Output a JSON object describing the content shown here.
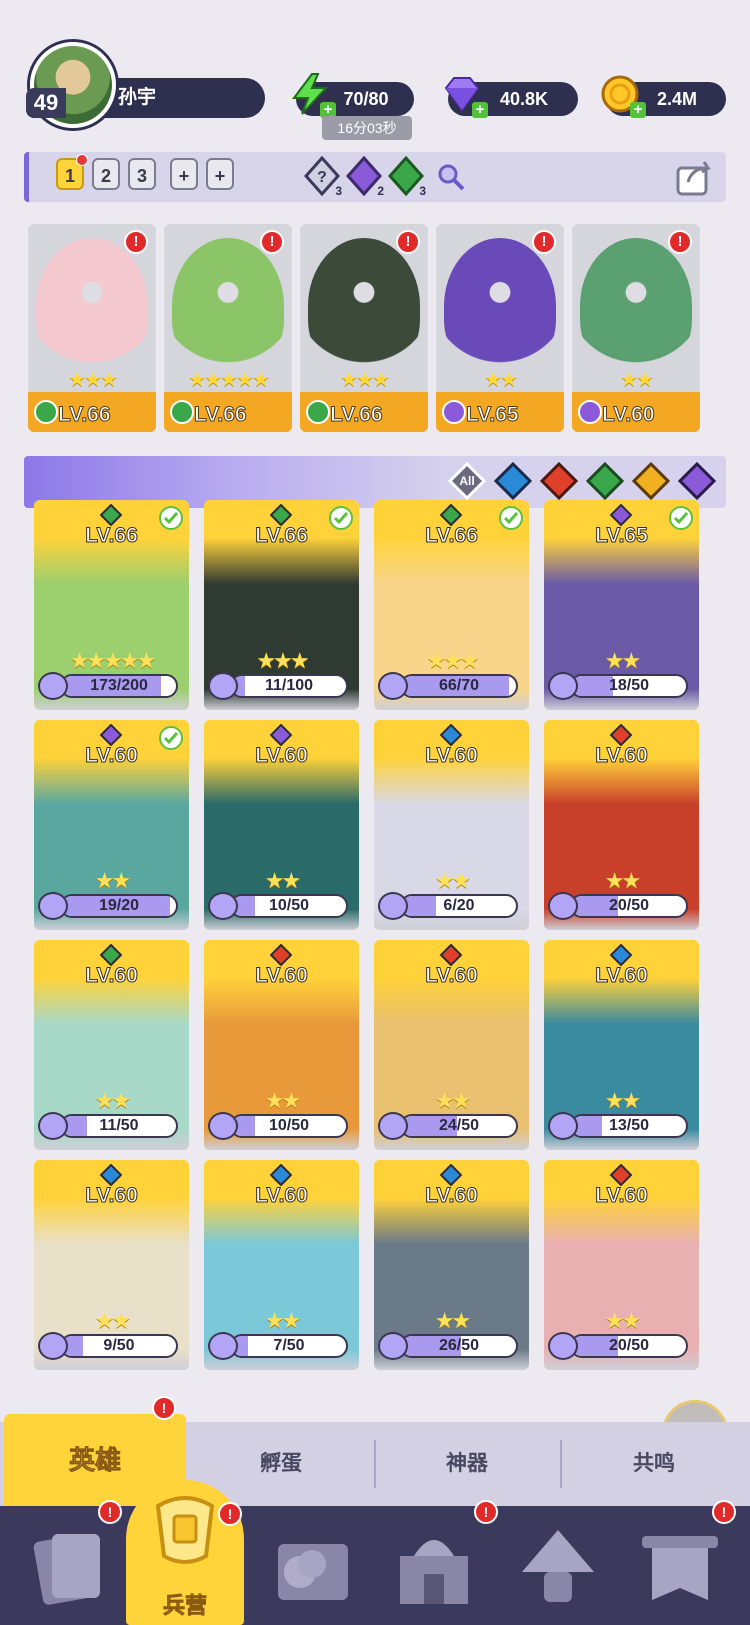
{
  "player": {
    "level": "49",
    "name": "孙宇"
  },
  "resources": {
    "energy": {
      "icon": "lightning-icon",
      "value": "70/80",
      "timer": "16分03秒"
    },
    "gems": {
      "icon": "gem-icon",
      "value": "40.8K"
    },
    "gold": {
      "icon": "coin-icon",
      "value": "2.4M"
    }
  },
  "teams": {
    "tabs": [
      "1",
      "2",
      "3",
      "+",
      "+"
    ],
    "active": "1",
    "element_counts": [
      "3",
      "2",
      "3"
    ]
  },
  "team_heroes": [
    {
      "element": "nature",
      "stars": "★★★",
      "level": "LV.66",
      "art": "#f5c9d0"
    },
    {
      "element": "nature",
      "stars": "★★★★★",
      "level": "LV.66",
      "art": "#8cc468"
    },
    {
      "element": "nature",
      "stars": "★★★",
      "level": "LV.66",
      "art": "#3c4a3a"
    },
    {
      "element": "dark",
      "stars": "★★",
      "level": "LV.65",
      "art": "#6a4ab8"
    },
    {
      "element": "dark",
      "stars": "★★",
      "level": "LV.60",
      "art": "#5aa070"
    }
  ],
  "filters": {
    "all_label": "All",
    "elements": [
      "water",
      "fire",
      "nature",
      "light",
      "dark"
    ]
  },
  "heroes": [
    {
      "element": "nature",
      "level": "LV.66",
      "stars": "★★★★★",
      "progress": "173/200",
      "ratio": 0.865,
      "equipped": true,
      "art": "#9ccf6e"
    },
    {
      "element": "nature",
      "level": "LV.66",
      "stars": "★★★",
      "progress": "11/100",
      "ratio": 0.11,
      "equipped": true,
      "art": "#2f3a32"
    },
    {
      "element": "nature",
      "level": "LV.66",
      "stars": "★★★",
      "progress": "66/70",
      "ratio": 0.94,
      "equipped": true,
      "art": "#f8d58a"
    },
    {
      "element": "dark",
      "level": "LV.65",
      "stars": "★★",
      "progress": "18/50",
      "ratio": 0.36,
      "equipped": true,
      "art": "#6a5aa8"
    },
    {
      "element": "dark",
      "level": "LV.60",
      "stars": "★★",
      "progress": "19/20",
      "ratio": 0.95,
      "equipped": true,
      "art": "#5aa7a0"
    },
    {
      "element": "dark",
      "level": "LV.60",
      "stars": "★★",
      "progress": "10/50",
      "ratio": 0.2,
      "equipped": false,
      "art": "#2a6a68"
    },
    {
      "element": "water",
      "level": "LV.60",
      "stars": "★★",
      "progress": "6/20",
      "ratio": 0.3,
      "equipped": false,
      "art": "#d8d8e6"
    },
    {
      "element": "fire",
      "level": "LV.60",
      "stars": "★★",
      "progress": "20/50",
      "ratio": 0.4,
      "equipped": false,
      "art": "#c8402a"
    },
    {
      "element": "nature",
      "level": "LV.60",
      "stars": "★★",
      "progress": "11/50",
      "ratio": 0.22,
      "equipped": false,
      "art": "#a8d8c8"
    },
    {
      "element": "fire",
      "level": "LV.60",
      "stars": "★★",
      "progress": "10/50",
      "ratio": 0.2,
      "equipped": false,
      "art": "#e89a3a"
    },
    {
      "element": "fire",
      "level": "LV.60",
      "stars": "★★",
      "progress": "24/50",
      "ratio": 0.48,
      "equipped": false,
      "art": "#e8c070"
    },
    {
      "element": "water",
      "level": "LV.60",
      "stars": "★★",
      "progress": "13/50",
      "ratio": 0.26,
      "equipped": false,
      "art": "#3a8aa0"
    },
    {
      "element": "water",
      "level": "LV.60",
      "stars": "★★",
      "progress": "9/50",
      "ratio": 0.18,
      "equipped": false,
      "art": "#e8e0c8"
    },
    {
      "element": "water",
      "level": "LV.60",
      "stars": "★★",
      "progress": "7/50",
      "ratio": 0.14,
      "equipped": false,
      "art": "#7ac8d8"
    },
    {
      "element": "water",
      "level": "LV.60",
      "stars": "★★",
      "progress": "26/50",
      "ratio": 0.52,
      "equipped": false,
      "art": "#6a7a88"
    },
    {
      "element": "fire",
      "level": "LV.60",
      "stars": "★★",
      "progress": "20/50",
      "ratio": 0.4,
      "equipped": false,
      "art": "#e8b0b0"
    }
  ],
  "sub_tabs": [
    {
      "label": "英雄",
      "active": true,
      "alert": true
    },
    {
      "label": "孵蛋",
      "active": false,
      "alert": false
    },
    {
      "label": "神器",
      "active": false,
      "alert": false
    },
    {
      "label": "共鸣",
      "active": false,
      "alert": false
    }
  ],
  "nav": {
    "active_label": "兵营",
    "items": [
      "cards-icon",
      "barracks-icon",
      "coins-book-icon",
      "castle-icon",
      "mushroom-icon",
      "banner-icon"
    ]
  },
  "colors": {
    "nature": "#3aa84a",
    "dark": "#8a5ad8",
    "water": "#2a8ad8",
    "fire": "#e0402a",
    "light": "#f0b020",
    "accent": "#ffd33a"
  }
}
